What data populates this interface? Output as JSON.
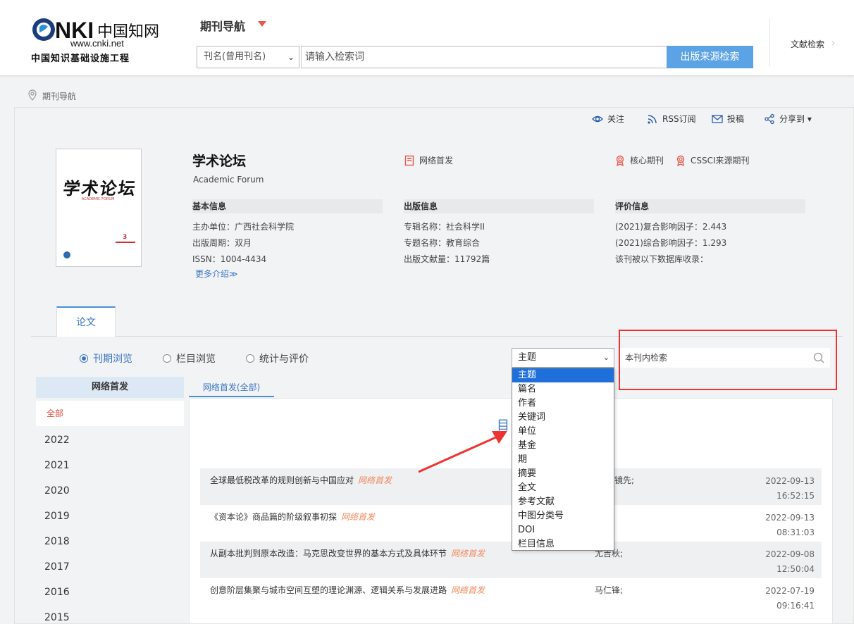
{
  "header": {
    "logo_text": "CNKI中国知网",
    "logo_url_text": "www.cnki.net",
    "logo_subtitle": "中国知识基础设施工程",
    "nav_title": "期刊导航",
    "field_select": "刊名(曾用刊名)",
    "search_placeholder": "请输入检索词",
    "search_button": "出版来源检索",
    "literature_search": "文献检索",
    "literature_arrow": "›"
  },
  "breadcrumb": "期刊导航",
  "toolbar": {
    "follow": "关注",
    "rss": "RSS订阅",
    "submit": "投稿",
    "share": "分享到 ▾"
  },
  "journal": {
    "cover_title": "学术论坛",
    "cover_sub": "ACADEMIC FORUM",
    "cover_issue": "3",
    "title": "学术论坛",
    "english": "Academic Forum",
    "tag_online": "网络首发",
    "tag_core": "核心期刊",
    "tag_cssci": "CSSCI来源期刊",
    "more": "更多介绍≫"
  },
  "info": {
    "basic": {
      "head": "基本信息",
      "lines": [
        "主办单位：广西社会科学院",
        "出版周期：双月",
        "ISSN：1004-4434"
      ]
    },
    "publish": {
      "head": "出版信息",
      "lines": [
        "专辑名称：社会科学II",
        "专题名称：教育综合",
        "出版文献量：11792篇"
      ]
    },
    "eval": {
      "head": "评价信息",
      "lines": [
        "(2021)复合影响因子：2.443",
        "(2021)综合影响因子：1.293",
        "该刊被以下数据库收录："
      ]
    }
  },
  "tabs": {
    "papers": "论文"
  },
  "browse": {
    "issue": "刊期浏览",
    "column": "栏目浏览",
    "stats": "统计与评价"
  },
  "search": {
    "field_value": "主题",
    "inner_placeholder": "本刊内检索"
  },
  "dropdown_options": [
    "主题",
    "篇名",
    "作者",
    "关键词",
    "单位",
    "基金",
    "期",
    "摘要",
    "全文",
    "参考文献",
    "中图分类号",
    "DOI",
    "栏目信息"
  ],
  "sidebar": {
    "head": "网络首发",
    "all": "全部",
    "years": [
      "2022",
      "2021",
      "2020",
      "2019",
      "2018",
      "2017",
      "2016",
      "2015"
    ]
  },
  "content": {
    "tab": "网络首发(全部)",
    "catalog": "目",
    "web_tag": "网络首发",
    "rows": [
      {
        "title": "全球最低税改革的规则创新与中国应对",
        "author": "静;陈镜先;",
        "date": "2022-09-13",
        "time": "16:52:15"
      },
      {
        "title": "《资本论》商品篇的阶级叙事初探",
        "author": "",
        "date": "2022-09-13",
        "time": "08:31:03"
      },
      {
        "title": "从副本批判到原本改造：马克思改变世界的基本方式及具体环节",
        "author": "尤吉秋;",
        "date": "2022-09-08",
        "time": "12:50:04"
      },
      {
        "title": "创意阶层集聚与城市空间互塑的理论渊源、逻辑关系与发展进路",
        "author": "马仁锋;",
        "date": "2022-07-19",
        "time": "09:16:41"
      }
    ]
  },
  "colors": {
    "accent": "#3a74c4",
    "button": "#5ba3e5",
    "red": "#e33333",
    "web_tag": "#f08a5d"
  }
}
